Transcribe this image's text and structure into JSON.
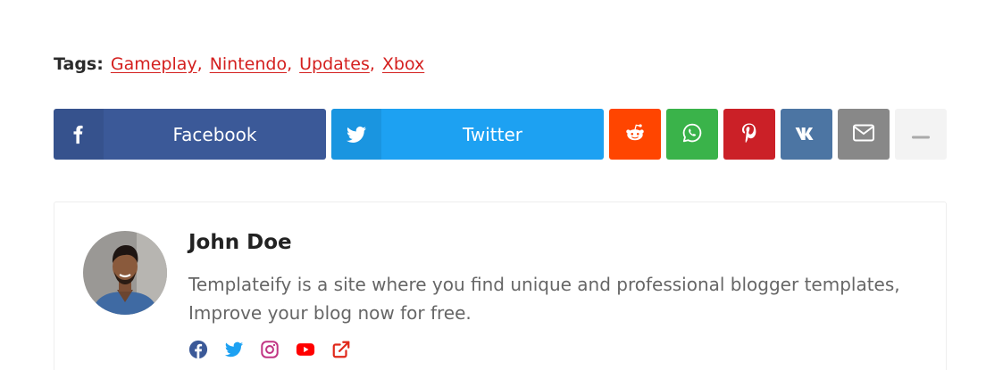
{
  "tags": {
    "label": "Tags:",
    "items": [
      "Gameplay",
      "Nintendo",
      "Updates",
      "Xbox"
    ]
  },
  "share": {
    "facebook_label": "Facebook",
    "twitter_label": "Twitter",
    "buttons": [
      {
        "name": "facebook",
        "icon": "facebook-icon",
        "color": "#3b5998"
      },
      {
        "name": "twitter",
        "icon": "twitter-icon",
        "color": "#1da1f2"
      },
      {
        "name": "reddit",
        "icon": "reddit-icon",
        "color": "#ff4500"
      },
      {
        "name": "whatsapp",
        "icon": "whatsapp-icon",
        "color": "#3ab34a"
      },
      {
        "name": "pinterest",
        "icon": "pinterest-icon",
        "color": "#cb2027"
      },
      {
        "name": "vk",
        "icon": "vk-icon",
        "color": "#4c75a3"
      },
      {
        "name": "email",
        "icon": "email-icon",
        "color": "#888888"
      },
      {
        "name": "more",
        "icon": "minus-icon",
        "color": "#f3f3f3"
      }
    ]
  },
  "author": {
    "name": "John Doe",
    "bio": "Templateify is a site where you find unique and professional blogger templates, Improve your blog now for free.",
    "social_icons": [
      {
        "icon": "facebook-icon",
        "color": "#3b5998"
      },
      {
        "icon": "twitter-icon",
        "color": "#1da1f2"
      },
      {
        "icon": "instagram-icon",
        "color": "#c13584"
      },
      {
        "icon": "youtube-icon",
        "color": "#ff0000"
      },
      {
        "icon": "external-link-icon",
        "color": "#e0291b"
      }
    ]
  }
}
